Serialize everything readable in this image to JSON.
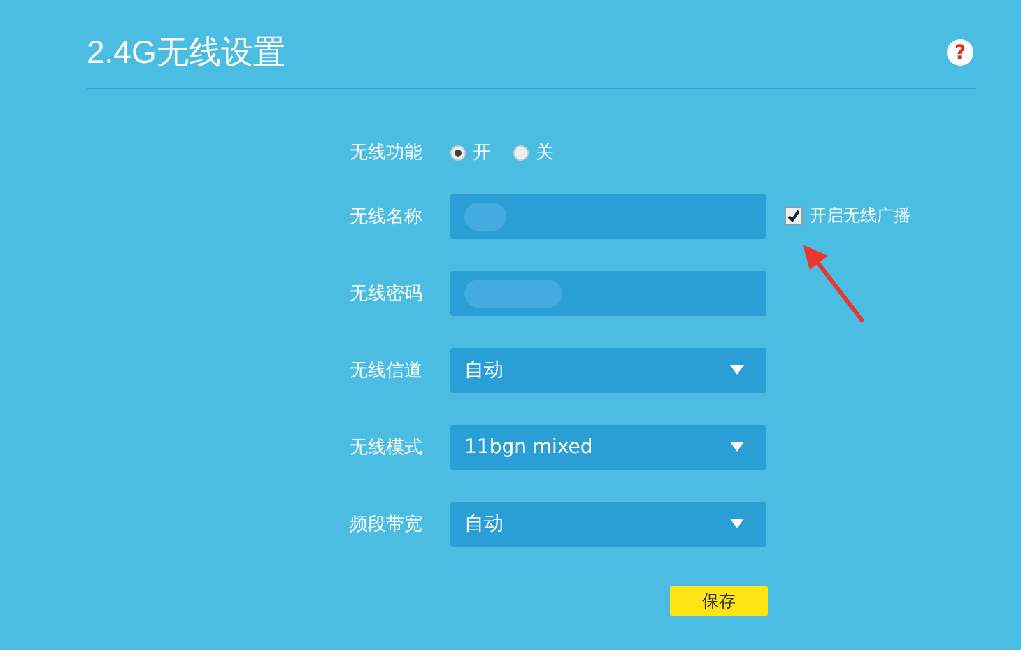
{
  "header": {
    "title": "2.4G无线设置",
    "help": "?"
  },
  "rows": [
    {
      "kind": "radio",
      "label": "无线功能",
      "options": [
        {
          "label": "开",
          "selected": true
        },
        {
          "label": "关",
          "selected": false
        }
      ]
    },
    {
      "kind": "text",
      "label": "无线名称",
      "blurred": true,
      "checkbox": {
        "label": "开启无线广播",
        "checked": true
      }
    },
    {
      "kind": "text",
      "label": "无线密码",
      "blurred": true
    },
    {
      "kind": "select",
      "label": "无线信道",
      "value": "自动"
    },
    {
      "kind": "select",
      "label": "无线模式",
      "value": "11bgn mixed"
    },
    {
      "kind": "select",
      "label": "频段带宽",
      "value": "自动"
    }
  ],
  "save_button": "保存"
}
